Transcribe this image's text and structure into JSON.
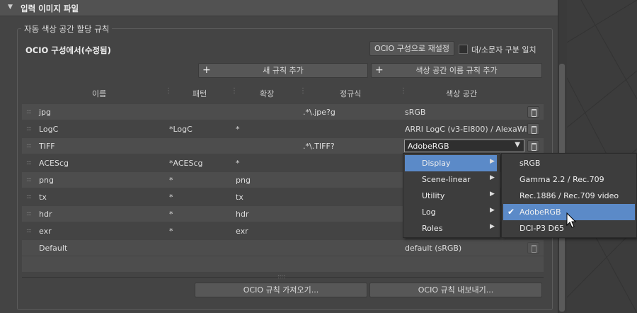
{
  "section": {
    "title": "입력 이미지 파일"
  },
  "group": {
    "title": "자동 색상 공간 할당 규칙"
  },
  "config": {
    "name": "OCIO 구성에서(수정됨)",
    "reset_button": "OCIO 구성으로 재설정",
    "case_sensitive_label": "대/소문자 구분 일치"
  },
  "toolbar": {
    "add_rule": "새 규칙 추가",
    "add_colorspace_rule": "색상 공간 이름 규칙 추가"
  },
  "columns": [
    "이름",
    "패턴",
    "확장",
    "정규식",
    "색상 공간"
  ],
  "rows": [
    {
      "name": "jpg",
      "pattern": "",
      "ext": "",
      "regex": ".*\\.jpe?g",
      "colorspace": "sRGB"
    },
    {
      "name": "LogC",
      "pattern": "*LogC",
      "ext": "*",
      "regex": "",
      "colorspace": "ARRI LogC (v3-EI800) / AlexaWide"
    },
    {
      "name": "TIFF",
      "pattern": "",
      "ext": "",
      "regex": ".*\\.TIFF?",
      "colorspace": "AdobeRGB"
    },
    {
      "name": "ACEScg",
      "pattern": "*ACEScg",
      "ext": "*",
      "regex": "",
      "colorspace": ""
    },
    {
      "name": "png",
      "pattern": "*",
      "ext": "png",
      "regex": "",
      "colorspace": ""
    },
    {
      "name": "tx",
      "pattern": "*",
      "ext": "tx",
      "regex": "",
      "colorspace": ""
    },
    {
      "name": "hdr",
      "pattern": "*",
      "ext": "hdr",
      "regex": "",
      "colorspace": ""
    },
    {
      "name": "exr",
      "pattern": "*",
      "ext": "exr",
      "regex": "",
      "colorspace": ""
    },
    {
      "name": "Default",
      "pattern": "",
      "ext": "",
      "regex": "",
      "colorspace": "default (sRGB)"
    }
  ],
  "combo": {
    "value": "AdobeRGB",
    "arrow": "▼"
  },
  "menu": {
    "categories": [
      "Display",
      "Scene-linear",
      "Utility",
      "Log",
      "Roles"
    ],
    "display_items": [
      "sRGB",
      "Gamma 2.2 / Rec.709",
      "Rec.1886 / Rec.709 video",
      "AdobeRGB",
      "DCI-P3 D65"
    ]
  },
  "footer": {
    "import": "OCIO 규칙 가져오기...",
    "export": "OCIO 규칙 내보내기..."
  }
}
